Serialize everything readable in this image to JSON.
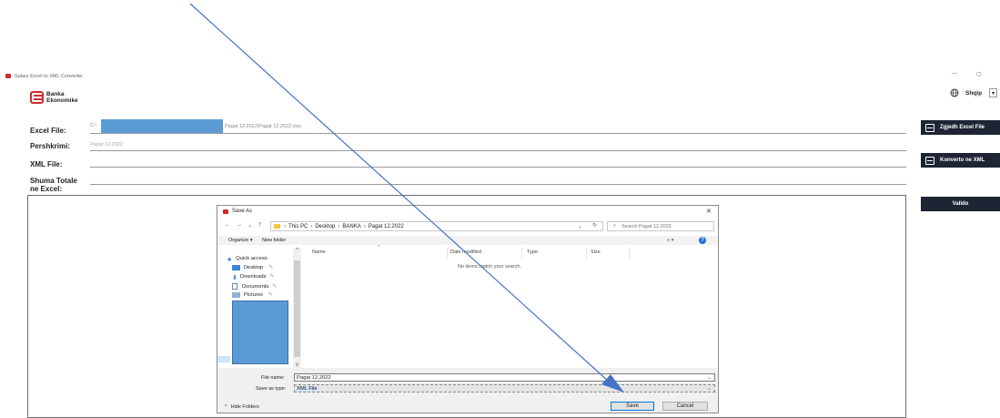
{
  "window": {
    "title": "Salary Excel to XML Converter",
    "minimize_glyph": "—",
    "restore_glyph": "▢"
  },
  "brand": {
    "line1": "Banka",
    "line2": "Ekonomike",
    "color": "#d42a2a"
  },
  "language": {
    "label": "Shqip",
    "icon": "globe-icon"
  },
  "form": {
    "excel_label": "Excel File:",
    "excel_value_prefix": "C:\\",
    "excel_value_suffix": "Pagat 12.2022\\Pagat 12.2022.xlsx",
    "desc_label": "Pershkrimi:",
    "desc_value": "Pagat 12.2022",
    "xml_label": "XML File:",
    "xml_value": "",
    "sum_label_1": "Shuma Totale",
    "sum_label_2": "ne Excel:",
    "sum_value": ""
  },
  "buttons": {
    "choose_excel": "Zgjedh Excel File",
    "convert": "Konverto ne XML",
    "validate": "Valido"
  },
  "dialog": {
    "title": "Save As",
    "close_glyph": "✕",
    "path": [
      "This PC",
      "Desktop",
      "BANKA",
      "Pagat 12.2022"
    ],
    "search_placeholder": "Search Pagat 12.2022",
    "organize": "Organize ▾",
    "new_folder": "New folder",
    "nav": {
      "quick_access": "Quick access",
      "desktop": "Desktop",
      "downloads": "Downloads",
      "documents": "Documents",
      "pictures": "Pictures"
    },
    "columns": {
      "name": "Name",
      "date": "Date modified",
      "type": "Type",
      "size": "Size"
    },
    "empty_message": "No items match your search.",
    "file_name_label": "File name:",
    "file_name_value": "Pagat 12.2022",
    "save_type_label": "Save as type:",
    "save_type_value": "XML File",
    "hide_folders": "Hide Folders",
    "save_button": "Save",
    "cancel_button": "Cancel"
  },
  "colors": {
    "sidebar_button": "#1d2433",
    "redaction": "#5b9bd5",
    "annotation_arrow": "#4472c4"
  }
}
